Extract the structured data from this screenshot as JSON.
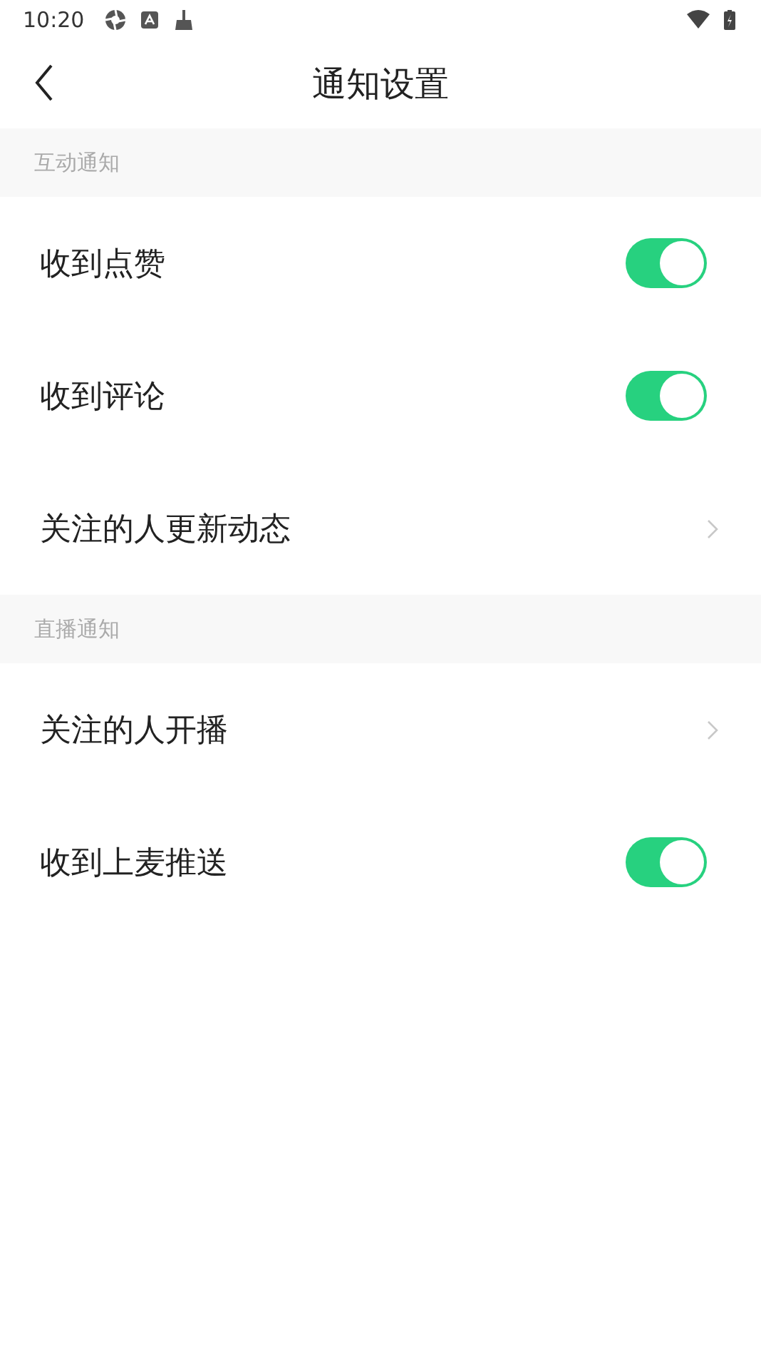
{
  "status_bar": {
    "time": "10:20"
  },
  "header": {
    "title": "通知设置"
  },
  "sections": [
    {
      "title": "互动通知",
      "rows": [
        {
          "label": "收到点赞",
          "kind": "toggle",
          "on": true
        },
        {
          "label": "收到评论",
          "kind": "toggle",
          "on": true
        },
        {
          "label": "关注的人更新动态",
          "kind": "link"
        }
      ]
    },
    {
      "title": "直播通知",
      "rows": [
        {
          "label": "关注的人开播",
          "kind": "link"
        },
        {
          "label": "收到上麦推送",
          "kind": "toggle",
          "on": true
        }
      ]
    }
  ]
}
